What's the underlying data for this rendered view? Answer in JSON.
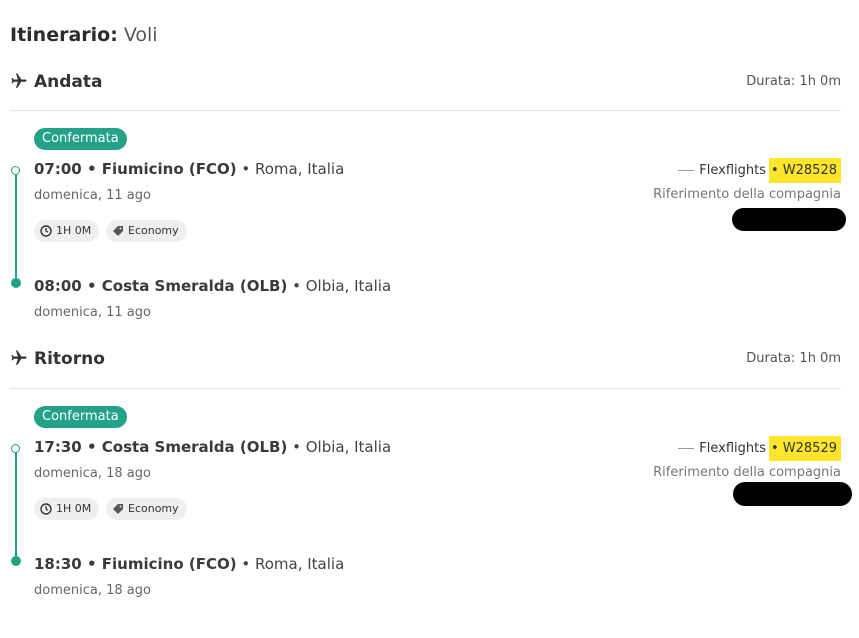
{
  "title": {
    "bold": "Itinerario:",
    "light": "Voli"
  },
  "sections": [
    {
      "title": "Andata",
      "duration": "Durata: 1h 0m",
      "status": "Confermata",
      "departure": {
        "time_place": "07:00 • Fiumicino (FCO)",
        "city": "• Roma, Italia",
        "date": "domenica, 11 ago"
      },
      "arrival": {
        "time_place": "08:00 • Costa Smeralda (OLB)",
        "city": "• Olbia, Italia",
        "date": "domenica, 11 ago"
      },
      "chips": {
        "duration": "1H 0M",
        "class": "Economy"
      },
      "airline": {
        "name": "Flexflights",
        "flight_number": "• W28528",
        "ref_label": "Riferimento della compagnia"
      }
    },
    {
      "title": "Ritorno",
      "duration": "Durata: 1h 0m",
      "status": "Confermata",
      "departure": {
        "time_place": "17:30 • Costa Smeralda (OLB)",
        "city": "• Olbia, Italia",
        "date": "domenica, 18 ago"
      },
      "arrival": {
        "time_place": "18:30 • Fiumicino (FCO)",
        "city": "• Roma, Italia",
        "date": "domenica, 18 ago"
      },
      "chips": {
        "duration": "1H 0M",
        "class": "Economy"
      },
      "airline": {
        "name": "Flexflights",
        "flight_number": "• W28529",
        "ref_label": "Riferimento della compagnia"
      }
    }
  ],
  "icons": {
    "section": "airplane-icon",
    "duration_chip": "clock-icon",
    "class_chip": "tag-icon"
  },
  "colors": {
    "accent": "#23a189",
    "highlight": "#fde52b",
    "redaction": "#000000"
  }
}
